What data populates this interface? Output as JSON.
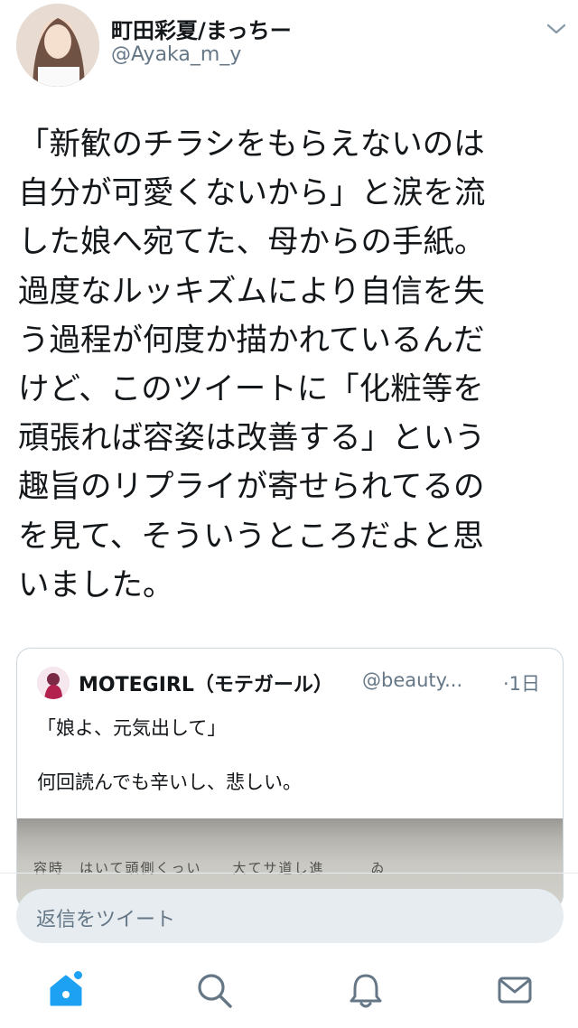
{
  "tweet": {
    "author": {
      "display_name": "町田彩夏/まっちー",
      "handle": "@Ayaka_m_y"
    },
    "text_lines": [
      "「新歓のチラシをもらえないのは",
      "自分が可愛くないから」と涙を流",
      "した娘へ宛てた、母からの手紙。",
      "過度なルッキズムにより自信を失",
      "う過程が何度か描かれているんだ",
      "けど、このツイートに「化粧等を",
      "頑張れば容姿は改善する」という",
      "趣旨のリプライが寄せられてるの",
      "を見て、そういうところだよと思",
      "いました。"
    ]
  },
  "quoted_tweet": {
    "display_name": "MOTEGIRL（モテガール）",
    "handle": "@beauty...",
    "time": "·1日",
    "line1": "「娘よ、元気出して」",
    "line2": "何回読んでも辛いし、悲しい。",
    "photo_text": "容時　はいて頭側くっい　　大てサ道し進　　　ゐ"
  },
  "reply": {
    "placeholder": "返信をツイート"
  },
  "tabbar": {
    "icons": [
      "home-icon",
      "search-icon",
      "notifications-icon",
      "messages-icon"
    ],
    "accent_color": "#1da1f2",
    "inactive_color": "#657786"
  }
}
